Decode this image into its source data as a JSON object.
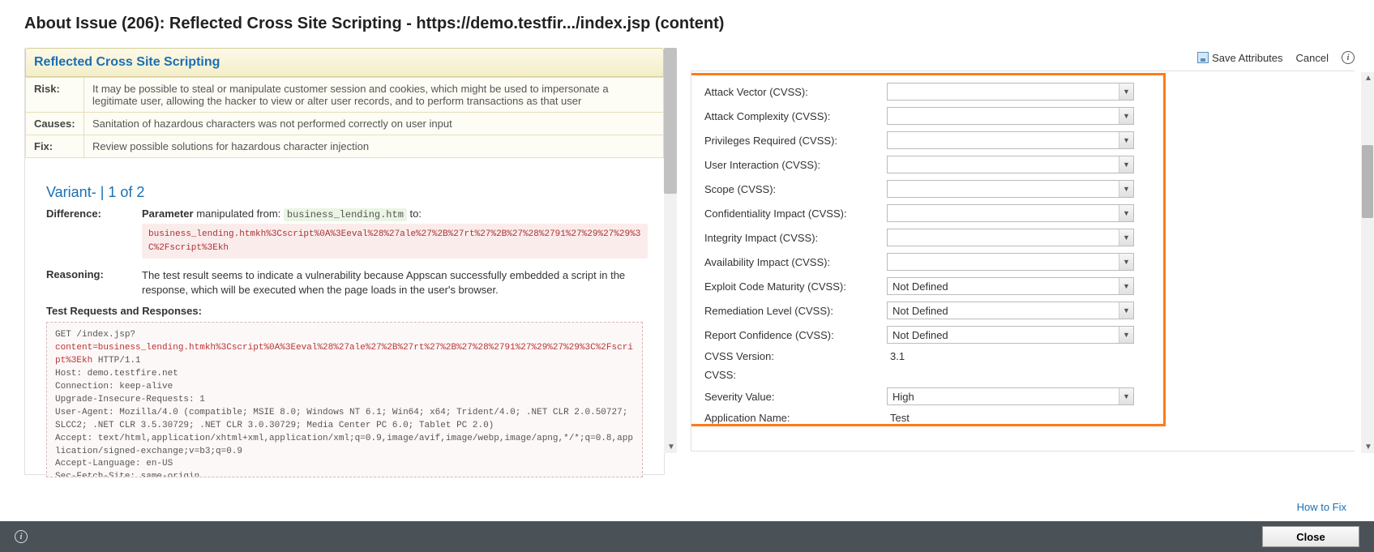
{
  "title": "About Issue (206): Reflected Cross Site Scripting - https://demo.testfir.../index.jsp (content)",
  "issue": {
    "header": "Reflected Cross Site Scripting",
    "risk_label": "Risk:",
    "risk": "It may be possible to steal or manipulate customer session and cookies, which might be used to impersonate a legitimate user, allowing the hacker to view or alter user records, and to perform transactions as that user",
    "causes_label": "Causes:",
    "causes": "Sanitation of hazardous characters was not performed correctly on user input",
    "fix_label": "Fix:",
    "fix": "Review possible solutions for hazardous character injection"
  },
  "variant": {
    "title": "Variant- | 1 of 2",
    "difference_label": "Difference:",
    "param_prefix": "Parameter",
    "manip_text": " manipulated from: ",
    "from_value": "business_lending.htm",
    "to_text": " to:",
    "to_value": "business_lending.htmkh%3Cscript%0A%3Eeval%28%27ale%27%2B%27rt%27%2B%27%28%2791%27%29%27%29%3C%2Fscript%3Ekh",
    "reasoning_label": "Reasoning:",
    "reasoning": "The test result seems to indicate a vulnerability because Appscan successfully embedded a script in the response, which will be executed when the page loads in the user's browser.",
    "test_req_title": "Test Requests and Responses:"
  },
  "http": {
    "line1": "GET /index.jsp?",
    "line2_red": "content=business_lending.htmkh%3Cscript%0A%3Eeval%28%27ale%27%2B%27rt%27%2B%27%28%2791%27%29%27%29%3C%2Fscript%3Ekh",
    "line2b": " HTTP/1.1",
    "rest": "Host: demo.testfire.net\nConnection: keep-alive\nUpgrade-Insecure-Requests: 1\nUser-Agent: Mozilla/4.0 (compatible; MSIE 8.0; Windows NT 6.1; Win64; x64; Trident/4.0; .NET CLR 2.0.50727; SLCC2; .NET CLR 3.5.30729; .NET CLR 3.0.30729; Media Center PC 6.0; Tablet PC 2.0)\nAccept: text/html,application/xhtml+xml,application/xml;q=0.9,image/avif,image/webp,image/apng,*/*;q=0.8,application/signed-exchange;v=b3;q=0.9\nAccept-Language: en-US\nSec-Fetch-Site: same-origin\nSec-Fetch-Mode: navigate\nSec-Fetch-User: ?1\nSec-Fetch-Dest: document\nReferer: https://demo.testfire.net/index.jsp?content=business_deposit.htm"
  },
  "toolbar": {
    "save_label": "Save Attributes",
    "cancel_label": "Cancel"
  },
  "attributes": [
    {
      "label": "Attack Vector (CVSS):",
      "type": "select",
      "value": ""
    },
    {
      "label": "Attack Complexity (CVSS):",
      "type": "select",
      "value": ""
    },
    {
      "label": "Privileges Required (CVSS):",
      "type": "select",
      "value": ""
    },
    {
      "label": "User Interaction (CVSS):",
      "type": "select",
      "value": ""
    },
    {
      "label": "Scope (CVSS):",
      "type": "select",
      "value": ""
    },
    {
      "label": "Confidentiality Impact (CVSS):",
      "type": "select",
      "value": ""
    },
    {
      "label": "Integrity Impact (CVSS):",
      "type": "select",
      "value": ""
    },
    {
      "label": "Availability Impact (CVSS):",
      "type": "select",
      "value": ""
    },
    {
      "label": "Exploit Code Maturity (CVSS):",
      "type": "select",
      "value": "Not Defined"
    },
    {
      "label": "Remediation Level (CVSS):",
      "type": "select",
      "value": "Not Defined"
    },
    {
      "label": "Report Confidence (CVSS):",
      "type": "select",
      "value": "Not Defined"
    },
    {
      "label": "CVSS Version:",
      "type": "static",
      "value": "3.1"
    },
    {
      "label": "CVSS:",
      "type": "static",
      "value": ""
    },
    {
      "label": "Severity Value:",
      "type": "select",
      "value": "High"
    },
    {
      "label": "Application Name:",
      "type": "static",
      "value": "Test"
    }
  ],
  "links": {
    "how_to_fix": "How to Fix"
  },
  "footer": {
    "close": "Close"
  }
}
